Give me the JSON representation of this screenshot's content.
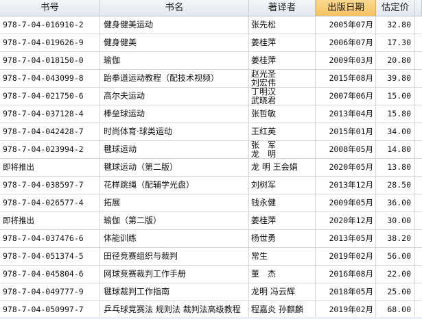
{
  "columns": {
    "isbn": "书号",
    "title": "书名",
    "author": "著译者",
    "date": "出版日期",
    "price": "估定价"
  },
  "rows": [
    {
      "isbn": "978-7-04-016910-2",
      "title": "健身健美运动",
      "author": [
        "张先松"
      ],
      "date": "2005年07月",
      "price": "32.80"
    },
    {
      "isbn": "978-7-04-019626-9",
      "title": "健身健美",
      "author": [
        "姜桂萍"
      ],
      "date": "2006年07月",
      "price": "17.30"
    },
    {
      "isbn": "978-7-04-018150-0",
      "title": "瑜伽",
      "author": [
        "姜桂萍"
      ],
      "date": "2009年03月",
      "price": "20.80"
    },
    {
      "isbn": "978-7-04-043099-8",
      "title": "跆拳道运动教程（配技术视频）",
      "author": [
        "赵光圣",
        "刘宏伟"
      ],
      "date": "2015年08月",
      "price": "39.80"
    },
    {
      "isbn": "978-7-04-021750-6",
      "title": "高尔夫运动",
      "author": [
        "丁明汉",
        "武晓君"
      ],
      "date": "2007年06月",
      "price": "15.00"
    },
    {
      "isbn": "978-7-04-037128-4",
      "title": "棒垒球运动",
      "author": [
        "张哲敏"
      ],
      "date": "2013年04月",
      "price": "15.80"
    },
    {
      "isbn": "978-7-04-042428-7",
      "title": "时尚体育·球类运动",
      "author": [
        "王红英"
      ],
      "date": "2015年01月",
      "price": "34.00"
    },
    {
      "isbn": "978-7-04-023994-2",
      "title": "毽球运动",
      "author": [
        "张　军",
        "龙　明"
      ],
      "date": "2008年05月",
      "price": "14.80"
    },
    {
      "isbn": "即将推出",
      "title": "毽球运动（第二版）",
      "author": [
        "龙 明 王会娟"
      ],
      "date": "2020年05月",
      "price": "13.80"
    },
    {
      "isbn": "978-7-04-038597-7",
      "title": "花样跳绳（配辅学光盘）",
      "author": [
        "刘树军"
      ],
      "date": "2013年12月",
      "price": "28.50"
    },
    {
      "isbn": "978-7-04-026577-4",
      "title": "拓展",
      "author": [
        "钱永健"
      ],
      "date": "2009年05月",
      "price": "36.00"
    },
    {
      "isbn": "即将推出",
      "title": "瑜伽（第二版）",
      "author": [
        "姜桂萍"
      ],
      "date": "2020年12月",
      "price": "30.00"
    },
    {
      "isbn": "978-7-04-037476-6",
      "title": "体能训练",
      "author": [
        "杨世勇"
      ],
      "date": "2013年05月",
      "price": "38.20"
    },
    {
      "isbn": "978-7-04-051374-5",
      "title": "田径竞赛组织与裁判",
      "author": [
        "常生"
      ],
      "date": "2019年02月",
      "price": "56.00"
    },
    {
      "isbn": "978-7-04-045804-6",
      "title": "网球竞赛裁判工作手册",
      "author": [
        "董　杰"
      ],
      "date": "2016年08月",
      "price": "22.00"
    },
    {
      "isbn": "978-7-04-049777-9",
      "title": "毽球裁判工作指南",
      "author": [
        "龙明 冯云辉"
      ],
      "date": "2018年05月",
      "price": "25.00"
    },
    {
      "isbn": "978-7-04-050997-7",
      "title": "乒乓球竞赛法 规则法 裁判法高级教程",
      "author": [
        "程嘉炎 孙麒麟"
      ],
      "date": "2019年02月",
      "price": "68.00"
    }
  ]
}
